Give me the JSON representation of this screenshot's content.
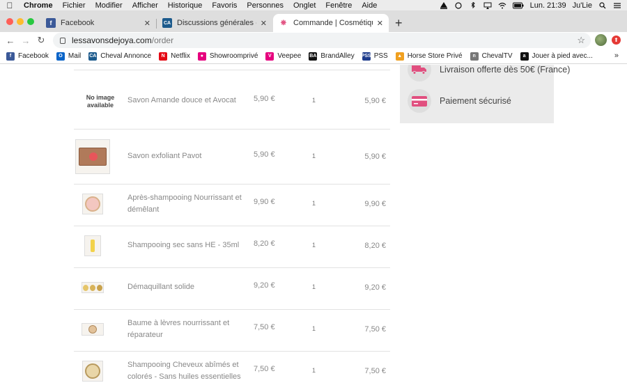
{
  "menubar": {
    "app": "Chrome",
    "items": [
      "Fichier",
      "Modifier",
      "Afficher",
      "Historique",
      "Favoris",
      "Personnes",
      "Onglet",
      "Fenêtre",
      "Aide"
    ],
    "clock": "Lun. 21:39",
    "user": "Ju'Lie"
  },
  "tabs": [
    {
      "title": "Facebook",
      "icon": "facebook-icon"
    },
    {
      "title": "Discussions générales - Forum",
      "icon": "cheval-annonce-icon"
    },
    {
      "title": "Commande | Cosmétiques solides",
      "icon": "savons-joya-icon"
    }
  ],
  "omnibox": {
    "domain": "lessavonsdejoya.com",
    "path": "/order"
  },
  "bookmarks": [
    {
      "label": "Facebook",
      "icon": "facebook-icon",
      "color": "#3b5998",
      "glyph": "f"
    },
    {
      "label": "Mail",
      "icon": "outlook-icon",
      "color": "#0a64c8",
      "glyph": "O"
    },
    {
      "label": "Cheval Annonce",
      "icon": "cheval-annonce-icon",
      "color": "#1c5a8c",
      "glyph": "CA"
    },
    {
      "label": "Netflix",
      "icon": "netflix-icon",
      "color": "#e50914",
      "glyph": "N"
    },
    {
      "label": "Showroomprivé",
      "icon": "showroomprive-icon",
      "color": "#e6007e",
      "glyph": "●"
    },
    {
      "label": "Veepee",
      "icon": "veepee-icon",
      "color": "#e6007e",
      "glyph": "V"
    },
    {
      "label": "BrandAlley",
      "icon": "brandalley-icon",
      "color": "#111111",
      "glyph": "BA"
    },
    {
      "label": "PSS",
      "icon": "pss-icon",
      "color": "#1e3c8c",
      "glyph": "PSS"
    },
    {
      "label": "Horse Store Privé",
      "icon": "horse-store-icon",
      "color": "#f0a020",
      "glyph": "▲"
    },
    {
      "label": "ChevalTV",
      "icon": "cheval-tv-icon",
      "color": "#777777",
      "glyph": "n"
    },
    {
      "label": "Jouer à pied avec...",
      "icon": "amazon-icon",
      "color": "#111111",
      "glyph": "a"
    }
  ],
  "bookmarks_more": "»",
  "order_items": [
    {
      "name": "Savon Amande douce et Avocat",
      "unit_price": "5,90 €",
      "qty": "1",
      "total": "5,90 €",
      "image": "no-image",
      "no_image_text": "No image available"
    },
    {
      "name": "Savon exfoliant Pavot",
      "unit_price": "5,90 €",
      "qty": "1",
      "total": "5,90 €",
      "image": "soap-bar"
    },
    {
      "name": "Après-shampooing Nourrissant et démêlant",
      "unit_price": "9,90 €",
      "qty": "1",
      "total": "9,90 €",
      "image": "tin-pink"
    },
    {
      "name": "Shampooing sec sans HE - 35ml",
      "unit_price": "8,20 €",
      "qty": "1",
      "total": "8,20 €",
      "image": "bottle"
    },
    {
      "name": "Démaquillant solide",
      "unit_price": "9,20 €",
      "qty": "1",
      "total": "9,20 €",
      "image": "pucks"
    },
    {
      "name": "Baume à lèvres nourrissant et réparateur",
      "unit_price": "7,50 €",
      "qty": "1",
      "total": "7,50 €",
      "image": "tin-small"
    },
    {
      "name": "Shampooing Cheveux abîmés et colorés - Sans huiles essentielles",
      "unit_price": "7,50 €",
      "qty": "1",
      "total": "7,50 €",
      "image": "tin-gold"
    }
  ],
  "features": [
    {
      "text": "Livraison offerte dès 50€ (France)",
      "icon": "truck-icon"
    },
    {
      "text": "Paiement sécurisé",
      "icon": "credit-card-icon"
    }
  ],
  "colors": {
    "accent": "#e14f7f",
    "feature_bg": "#ebebeb"
  }
}
